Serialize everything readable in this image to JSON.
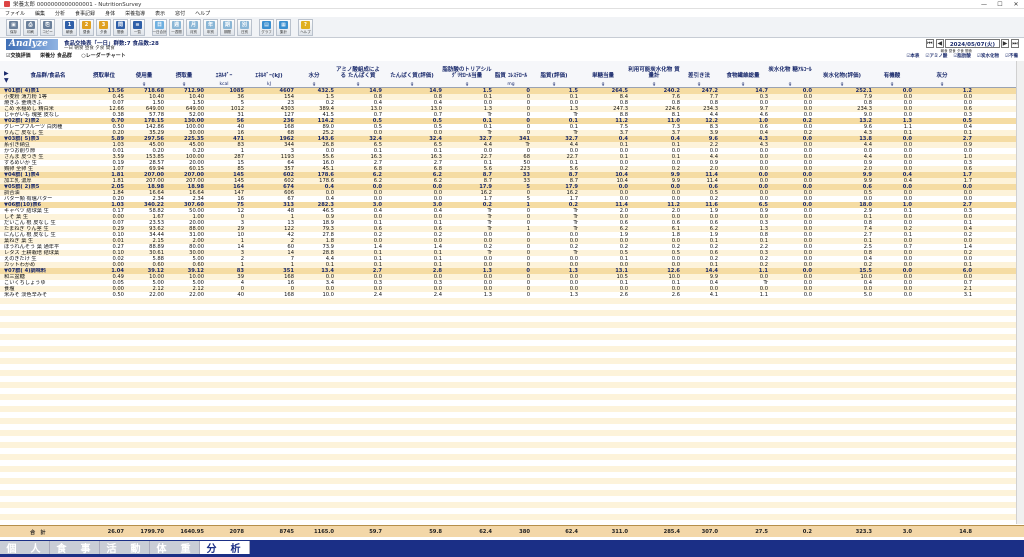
{
  "window": {
    "title": "栄養太郎 0000000000000001 - NutritionSurvey",
    "minimize": "—",
    "maximize": "☐",
    "close": "✕"
  },
  "menu": [
    "ファイル",
    "編集",
    "分析",
    "食事記録",
    "身体",
    "栄養指導",
    "表示",
    "窓付",
    "ヘルプ"
  ],
  "toolbar": [
    {
      "label": "保存",
      "color": "#6a7f9a",
      "glyph": "▣"
    },
    {
      "label": "印刷",
      "color": "#6a7f9a",
      "glyph": "⎙"
    },
    {
      "label": "コピー",
      "color": "#6a7f9a",
      "glyph": "⎘"
    },
    {
      "label": "朝食",
      "color": "#2f5fa8",
      "glyph": "1"
    },
    {
      "label": "昼食",
      "color": "#e0a020",
      "glyph": "2"
    },
    {
      "label": "夕食",
      "color": "#e0a020",
      "glyph": "3"
    },
    {
      "label": "間食",
      "color": "#2f5fa8",
      "glyph": "間"
    },
    {
      "label": "一覧",
      "color": "#2f5fa8",
      "glyph": "≡"
    },
    {
      "label": "一日合計",
      "color": "#6fb0e0",
      "glyph": "日"
    },
    {
      "label": "一週間",
      "color": "#8ab6d6",
      "glyph": "週"
    },
    {
      "label": "月別",
      "color": "#8ab6d6",
      "glyph": "月"
    },
    {
      "label": "年別",
      "color": "#8ab6d6",
      "glyph": "年"
    },
    {
      "label": "期間",
      "color": "#8ab6d6",
      "glyph": "期"
    },
    {
      "label": "日別",
      "color": "#8ab6d6",
      "glyph": "別"
    },
    {
      "label": "グラフ",
      "color": "#3a8fd0",
      "glyph": "▤"
    },
    {
      "label": "集計",
      "color": "#3a8fd0",
      "glyph": "▦"
    },
    {
      "label": "ヘルプ",
      "color": "#e0b020",
      "glyph": "?"
    }
  ],
  "analyze": {
    "logo": "Analyze",
    "info1": "食品交換表「一日」群数:7 食品数:28",
    "info2": "一日  朝食  昼食  夕食  間食",
    "opt1": "☑交換評価",
    "opt2": "栄養分 食品群",
    "opt3": "○レーダーチャート",
    "date": "2024/05/07(火)",
    "sub": "朝食 昼食 夕食 間食",
    "checks": [
      "☑本表",
      "☑アミノ酸",
      "☑脂肪酸",
      "☑炭水化物",
      "☑不備"
    ]
  },
  "columns": [
    {
      "key": "name",
      "label": "食品群/食品名",
      "unit": ""
    },
    {
      "key": "c1",
      "label": "摂取単位",
      "unit": ""
    },
    {
      "key": "c2",
      "label": "使用量",
      "unit": "g"
    },
    {
      "key": "c3",
      "label": "摂取量",
      "unit": "g"
    },
    {
      "key": "c4",
      "label": "ｴﾈﾙｷﾞｰ",
      "unit": "kcal"
    },
    {
      "key": "c5",
      "label": "ｴﾈﾙｷﾞｰ(kJ)",
      "unit": "kJ"
    },
    {
      "key": "c6",
      "label": "水分",
      "unit": "g"
    },
    {
      "key": "c7",
      "label": "アミノ酸組成による たんぱく質",
      "unit": "g"
    },
    {
      "key": "c8",
      "label": "たんぱく質(評価)",
      "unit": "g"
    },
    {
      "key": "c9",
      "label": "脂肪酸のトリアシル ｸﾞﾘｾﾛｰﾙ当量",
      "unit": "g"
    },
    {
      "key": "c10",
      "label": "脂質 ｺﾚｽﾃﾛｰﾙ",
      "unit": "mg"
    },
    {
      "key": "c11",
      "label": "脂質(評価)",
      "unit": "g"
    },
    {
      "key": "c12",
      "label": "単糖当量",
      "unit": "g"
    },
    {
      "key": "c13",
      "label": "利用可能炭水化物 質量計",
      "unit": "g"
    },
    {
      "key": "c14",
      "label": "差引き法",
      "unit": "g"
    },
    {
      "key": "c15",
      "label": "食物繊維総量",
      "unit": "g"
    },
    {
      "key": "c16",
      "label": "炭水化物 糖ｱﾙｺｰﾙ",
      "unit": "g"
    },
    {
      "key": "c17",
      "label": "炭水化物(評価)",
      "unit": "g"
    },
    {
      "key": "c18",
      "label": "有機酸",
      "unit": "g"
    },
    {
      "key": "c19",
      "label": "灰分",
      "unit": "g"
    }
  ],
  "rows": [
    {
      "g": true,
      "v": [
        "01群( 4)表1",
        "13.56",
        "718.68",
        "712.90",
        "1085",
        "4607",
        "432.5",
        "14.9",
        "14.9",
        "1.5",
        "0",
        "1.5",
        "264.5",
        "240.2",
        "247.2",
        "14.7",
        "0.0",
        "252.1",
        "0.0",
        "1.2"
      ]
    },
    {
      "v": [
        "小麦粉 薄力粉 1等",
        "0.45",
        "10.40",
        "10.40",
        "36",
        "154",
        "1.5",
        "0.8",
        "0.8",
        "0.1",
        "0",
        "0.1",
        "8.4",
        "7.6",
        "7.7",
        "0.3",
        "0.0",
        "7.9",
        "0.0",
        "0.0"
      ]
    },
    {
      "v": [
        "焼きふ 釜焼きふ",
        "0.07",
        "1.50",
        "1.50",
        "5",
        "23",
        "0.2",
        "0.4",
        "0.4",
        "0.0",
        "0",
        "0.0",
        "0.8",
        "0.8",
        "0.8",
        "0.0",
        "0.0",
        "0.8",
        "0.0",
        "0.0"
      ]
    },
    {
      "v": [
        "こめ 水稲めし 精白米",
        "12.66",
        "649.00",
        "649.00",
        "1012",
        "4303",
        "389.4",
        "13.0",
        "13.0",
        "1.3",
        "0",
        "1.3",
        "247.3",
        "224.6",
        "234.3",
        "9.7",
        "0.0",
        "234.3",
        "0.0",
        "0.6"
      ]
    },
    {
      "v": [
        "じゃがいも 塊茎 皮なし",
        "0.38",
        "57.78",
        "52.00",
        "31",
        "127",
        "41.5",
        "0.7",
        "0.7",
        "Tr",
        "0",
        "Tr",
        "8.8",
        "8.1",
        "4.4",
        "4.6",
        "0.0",
        "9.0",
        "0.0",
        "0.3"
      ]
    },
    {
      "g": true,
      "v": [
        "02群( 2)表2",
        "0.70",
        "178.15",
        "130.00",
        "56",
        "236",
        "114.2",
        "0.5",
        "0.5",
        "0.1",
        "0",
        "0.1",
        "11.2",
        "11.0",
        "12.2",
        "1.0",
        "0.2",
        "13.2",
        "1.3",
        "0.5"
      ]
    },
    {
      "v": [
        "グレープフルーツ 白肉種",
        "0.50",
        "142.86",
        "100.00",
        "40",
        "168",
        "89.0",
        "0.5",
        "0.5",
        "0.1",
        "0",
        "0.1",
        "7.5",
        "7.3",
        "8.3",
        "0.6",
        "0.0",
        "9.6",
        "1.1",
        "0.4"
      ]
    },
    {
      "v": [
        "りんご 皮なし 生",
        "0.20",
        "35.29",
        "30.00",
        "16",
        "68",
        "25.2",
        "0.0",
        "0.0",
        "Tr",
        "0",
        "Tr",
        "3.7",
        "3.7",
        "3.9",
        "0.4",
        "0.2",
        "4.3",
        "0.1",
        "0.1"
      ]
    },
    {
      "g": true,
      "v": [
        "03群( 5)表3",
        "5.89",
        "297.56",
        "225.35",
        "471",
        "1962",
        "143.6",
        "32.4",
        "32.4",
        "32.7",
        "341",
        "32.7",
        "0.4",
        "0.4",
        "9.6",
        "4.3",
        "0.0",
        "13.8",
        "0.0",
        "2.7"
      ]
    },
    {
      "v": [
        "糸引き納豆",
        "1.03",
        "45.00",
        "45.00",
        "83",
        "344",
        "26.8",
        "6.5",
        "6.5",
        "4.4",
        "Tr",
        "4.4",
        "0.1",
        "0.1",
        "2.2",
        "4.3",
        "0.0",
        "4.4",
        "0.0",
        "0.9"
      ]
    },
    {
      "v": [
        "かつお削り節",
        "0.01",
        "0.20",
        "0.20",
        "1",
        "3",
        "0.0",
        "0.1",
        "0.1",
        "0.0",
        "0",
        "0.0",
        "0.0",
        "0.0",
        "0.0",
        "0.0",
        "0.0",
        "0.0",
        "0.0",
        "0.0"
      ]
    },
    {
      "v": [
        "さんま 皮つき 生",
        "3.59",
        "153.85",
        "100.00",
        "287",
        "1193",
        "55.6",
        "16.3",
        "16.3",
        "22.7",
        "68",
        "22.7",
        "0.1",
        "0.1",
        "4.4",
        "0.0",
        "0.0",
        "4.4",
        "0.0",
        "1.0"
      ]
    },
    {
      "v": [
        "するめいか 生",
        "0.19",
        "28.57",
        "20.00",
        "15",
        "64",
        "16.0",
        "2.7",
        "2.7",
        "0.1",
        "50",
        "0.1",
        "0.0",
        "0.0",
        "0.9",
        "0.0",
        "0.0",
        "0.9",
        "0.0",
        "0.3"
      ]
    },
    {
      "v": [
        "鶏卵 全卵 生",
        "1.07",
        "69.94",
        "60.15",
        "85",
        "357",
        "45.1",
        "6.8",
        "6.8",
        "5.6",
        "223",
        "5.6",
        "0.2",
        "0.2",
        "2.0",
        "0.0",
        "0.0",
        "2.0",
        "0.0",
        "0.6"
      ]
    },
    {
      "g": true,
      "v": [
        "04群( 1)表4",
        "1.81",
        "207.00",
        "207.00",
        "145",
        "602",
        "178.6",
        "6.2",
        "6.2",
        "8.7",
        "33",
        "8.7",
        "10.4",
        "9.9",
        "11.4",
        "0.0",
        "0.0",
        "9.9",
        "0.4",
        "1.7"
      ]
    },
    {
      "v": [
        "加工乳 濃厚",
        "1.81",
        "207.00",
        "207.00",
        "145",
        "602",
        "178.6",
        "6.2",
        "6.2",
        "8.7",
        "33",
        "8.7",
        "10.4",
        "9.9",
        "11.4",
        "0.0",
        "0.0",
        "9.9",
        "0.4",
        "1.7"
      ]
    },
    {
      "g": true,
      "v": [
        "05群( 2)表5",
        "2.05",
        "18.98",
        "18.98",
        "164",
        "674",
        "0.4",
        "0.0",
        "0.0",
        "17.9",
        "5",
        "17.9",
        "0.0",
        "0.0",
        "0.6",
        "0.0",
        "0.0",
        "0.6",
        "0.0",
        "0.0"
      ]
    },
    {
      "v": [
        "調合油",
        "1.84",
        "16.64",
        "16.64",
        "147",
        "606",
        "0.0",
        "0.0",
        "0.0",
        "16.2",
        "0",
        "16.2",
        "0.0",
        "0.0",
        "0.5",
        "0.0",
        "0.0",
        "0.5",
        "0.0",
        "0.0"
      ]
    },
    {
      "v": [
        "バター類 有塩バター",
        "0.20",
        "2.34",
        "2.34",
        "16",
        "67",
        "0.4",
        "0.0",
        "0.0",
        "1.7",
        "5",
        "1.7",
        "0.0",
        "0.0",
        "0.2",
        "0.0",
        "0.0",
        "0.0",
        "0.0",
        "0.0"
      ]
    },
    {
      "g": true,
      "v": [
        "06群(10)表6",
        "1.03",
        "340.22",
        "307.60",
        "75",
        "313",
        "282.3",
        "3.0",
        "3.0",
        "0.2",
        "1",
        "0.2",
        "11.4",
        "11.2",
        "11.6",
        "6.5",
        "0.0",
        "18.0",
        "1.0",
        "2.7"
      ]
    },
    {
      "v": [
        "キャベツ 結球葉 生",
        "0.17",
        "58.82",
        "50.00",
        "12",
        "48",
        "46.5",
        "0.4",
        "0.4",
        "Tr",
        "0",
        "Tr",
        "2.0",
        "2.0",
        "1.9",
        "0.9",
        "0.0",
        "2.9",
        "0.1",
        "0.3"
      ]
    },
    {
      "v": [
        "しそ 葉 生",
        "0.00",
        "1.67",
        "1.00",
        "0",
        "1",
        "0.9",
        "0.0",
        "0.0",
        "Tr",
        "0",
        "Tr",
        "0.0",
        "0.0",
        "0.0",
        "0.0",
        "0.0",
        "0.1",
        "0.0",
        "0.0"
      ]
    },
    {
      "v": [
        "だいこん 根 皮なし 生",
        "0.07",
        "23.53",
        "20.00",
        "3",
        "13",
        "18.9",
        "0.1",
        "0.1",
        "Tr",
        "0",
        "Tr",
        "0.6",
        "0.6",
        "0.6",
        "0.3",
        "0.0",
        "0.8",
        "0.0",
        "0.1"
      ]
    },
    {
      "v": [
        "たまねぎ りん茎 生",
        "0.29",
        "93.62",
        "88.00",
        "29",
        "122",
        "79.3",
        "0.6",
        "0.6",
        "Tr",
        "1",
        "Tr",
        "6.2",
        "6.1",
        "6.2",
        "1.3",
        "0.0",
        "7.4",
        "0.2",
        "0.4"
      ]
    },
    {
      "v": [
        "にんじん 根 皮なし 生",
        "0.10",
        "34.44",
        "31.00",
        "10",
        "42",
        "27.8",
        "0.2",
        "0.2",
        "0.0",
        "0",
        "0.0",
        "1.9",
        "1.8",
        "1.9",
        "0.8",
        "0.0",
        "2.7",
        "0.1",
        "0.2"
      ]
    },
    {
      "v": [
        "葉ねぎ 葉 生",
        "0.01",
        "2.15",
        "2.00",
        "1",
        "2",
        "1.8",
        "0.0",
        "0.0",
        "0.0",
        "0",
        "0.0",
        "0.0",
        "0.0",
        "0.1",
        "0.1",
        "0.0",
        "0.1",
        "0.0",
        "0.0"
      ]
    },
    {
      "v": [
        "ほうれんそう 葉 通年平",
        "0.27",
        "88.89",
        "80.00",
        "14",
        "60",
        "73.9",
        "1.4",
        "1.4",
        "0.2",
        "0",
        "0.2",
        "0.2",
        "0.2",
        "0.2",
        "2.2",
        "0.0",
        "2.5",
        "0.7",
        "1.4"
      ]
    },
    {
      "v": [
        "レタス 土耕栽培 結球葉",
        "0.10",
        "30.61",
        "30.00",
        "3",
        "14",
        "28.8",
        "0.1",
        "0.1",
        "Tr",
        "0",
        "Tr",
        "0.5",
        "0.5",
        "0.6",
        "0.3",
        "0.0",
        "0.8",
        "0.0",
        "0.2"
      ]
    },
    {
      "v": [
        "えのきたけ 生",
        "0.02",
        "5.88",
        "5.00",
        "2",
        "7",
        "4.4",
        "0.1",
        "0.1",
        "0.0",
        "0",
        "0.0",
        "0.1",
        "0.0",
        "0.2",
        "0.2",
        "0.0",
        "0.4",
        "0.0",
        "0.0"
      ]
    },
    {
      "v": [
        "カットわかめ",
        "0.00",
        "0.60",
        "0.60",
        "1",
        "1",
        "0.1",
        "0.1",
        "0.1",
        "0.0",
        "0",
        "0.0",
        "0.0",
        "0.0",
        "0.1",
        "0.2",
        "0.0",
        "0.2",
        "0.0",
        "0.1"
      ]
    },
    {
      "g": true,
      "v": [
        "07群( 4)調味料",
        "1.04",
        "39.12",
        "39.12",
        "83",
        "351",
        "13.4",
        "2.7",
        "2.8",
        "1.3",
        "0",
        "1.3",
        "13.1",
        "12.6",
        "14.4",
        "1.1",
        "0.0",
        "15.5",
        "0.0",
        "6.0"
      ]
    },
    {
      "v": [
        "和三盆糖",
        "0.49",
        "10.00",
        "10.00",
        "39",
        "168",
        "0.0",
        "0.0",
        "0.0",
        "0.0",
        "0",
        "0.0",
        "10.5",
        "10.0",
        "9.9",
        "0.0",
        "0.0",
        "10.0",
        "0.0",
        "0.0"
      ]
    },
    {
      "v": [
        "こいくちしょうゆ",
        "0.05",
        "5.00",
        "5.00",
        "4",
        "16",
        "3.4",
        "0.3",
        "0.3",
        "0.0",
        "0",
        "0.0",
        "0.1",
        "0.1",
        "0.4",
        "Tr",
        "0.0",
        "0.4",
        "0.0",
        "0.7"
      ]
    },
    {
      "v": [
        "食塩",
        "0.00",
        "2.12",
        "2.12",
        "0",
        "0",
        "0.0",
        "0.0",
        "0.0",
        "0.0",
        "0",
        "0.0",
        "0.0",
        "0.0",
        "0.0",
        "0.0",
        "0.0",
        "0.0",
        "0.0",
        "2.1"
      ]
    },
    {
      "v": [
        "米みそ 淡色辛みそ",
        "0.50",
        "22.00",
        "22.00",
        "40",
        "168",
        "10.0",
        "2.4",
        "2.4",
        "1.3",
        "0",
        "1.3",
        "2.6",
        "2.6",
        "4.1",
        "1.1",
        "0.0",
        "5.0",
        "0.0",
        "3.1"
      ]
    }
  ],
  "total": {
    "label": "合　計",
    "v": [
      "26.07",
      "1799.70",
      "1640.95",
      "2078",
      "8745",
      "1165.0",
      "59.7",
      "59.8",
      "62.4",
      "380",
      "62.4",
      "311.0",
      "285.4",
      "307.0",
      "27.5",
      "0.2",
      "323.3",
      "3.0",
      "14.8"
    ]
  },
  "tabs": [
    "個　人",
    "食　事",
    "活　動",
    "体　重",
    "分　析"
  ],
  "active_tab": 4
}
